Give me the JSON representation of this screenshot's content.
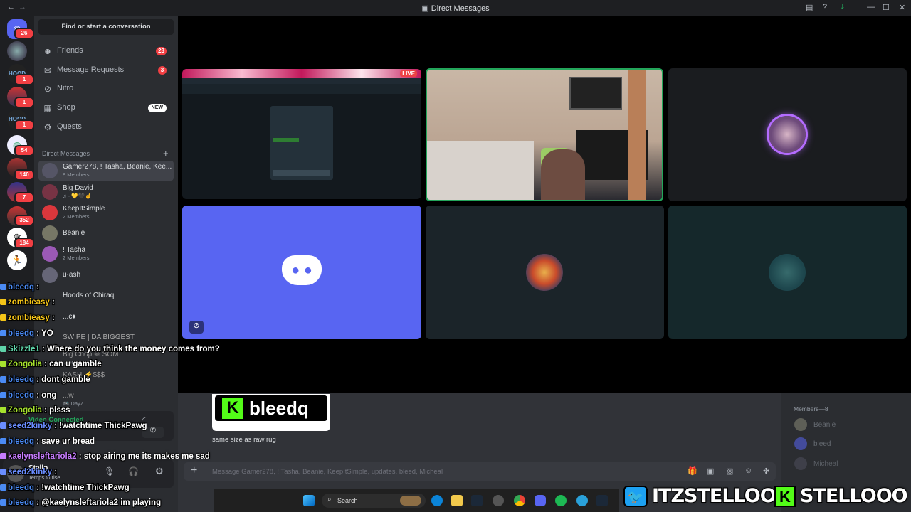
{
  "window": {
    "title": "Direct Messages"
  },
  "guild_badges": [
    "26",
    "1",
    "1",
    "1",
    "54",
    "140",
    "7",
    "352",
    "184"
  ],
  "dm_panel": {
    "find_label": "Find or start a conversation",
    "nav": [
      {
        "label": "Friends",
        "badge": "23",
        "icon": "friends-icon"
      },
      {
        "label": "Message Requests",
        "badge": "3",
        "icon": "mail-icon"
      },
      {
        "label": "Nitro",
        "badge": "",
        "icon": "nitro-icon"
      },
      {
        "label": "Shop",
        "badge": "NEW",
        "icon": "shop-icon"
      },
      {
        "label": "Quests",
        "badge": "",
        "icon": "quests-icon"
      }
    ],
    "dm_header": "Direct Messages",
    "dms": [
      {
        "name": "Gamer278, ! Tasha, Beanie, Kee...",
        "sub": "8 Members"
      },
      {
        "name": "Big David",
        "sub": "♫ · 💛🖤✌"
      },
      {
        "name": "KeepItSimple",
        "sub": "2 Members"
      },
      {
        "name": "Beanie",
        "sub": ""
      },
      {
        "name": "! Tasha",
        "sub": "2 Members"
      },
      {
        "name": "u·ash",
        "sub": ""
      },
      {
        "name": "Hoods of Chiraq",
        "sub": ""
      },
      {
        "name": "...c♦",
        "sub": ""
      },
      {
        "name": "SWIPE | DA BIGGEST",
        "sub": ""
      },
      {
        "name": "Big Chop  ☠ SOM",
        "sub": "...ter ...Medal"
      },
      {
        "name": "KASH ⚡$$$",
        "sub": ""
      },
      {
        "name": "...w",
        "sub": "🎮 DayZ"
      }
    ]
  },
  "stage": {
    "live_label": "LIVE"
  },
  "voice": {
    "status": "Video Connected"
  },
  "user": {
    "name": "Stello",
    "status": "Temps to rise"
  },
  "chat": {
    "image_text": "bleedq",
    "message": "same size as raw rug",
    "input_placeholder": "Message Gamer278, ! Tasha, Beanie, KeepItSimple, updates, bleed, Micheal"
  },
  "members": {
    "header": "Members—8",
    "items": [
      "Beanie",
      "bleed",
      "Micheal"
    ]
  },
  "taskbar": {
    "search_label": "Search"
  },
  "stream_chat": [
    {
      "user": "bleedq",
      "color": "#4b8bf5",
      "text": ""
    },
    {
      "user": "zombieasy",
      "color": "#f5c518",
      "text": ""
    },
    {
      "user": "zombieasy",
      "color": "#f5c518",
      "text": ""
    },
    {
      "user": "bleedq",
      "color": "#4b8bf5",
      "text": "YO"
    },
    {
      "user": "Skizzle1",
      "color": "#5fd3a8",
      "text": "Where do you think the money comes from?"
    },
    {
      "user": "Zongolia",
      "color": "#a6e22e",
      "text": "can u gamble"
    },
    {
      "user": "bleedq",
      "color": "#4b8bf5",
      "text": "dont gamble"
    },
    {
      "user": "bleedq",
      "color": "#4b8bf5",
      "text": "ong"
    },
    {
      "user": "Zongolia",
      "color": "#a6e22e",
      "text": "plsss"
    },
    {
      "user": "seed2kinky",
      "color": "#6a8dff",
      "text": "!watchtime ThickPawg"
    },
    {
      "user": "bleedq",
      "color": "#4b8bf5",
      "text": "save ur bread"
    },
    {
      "user": "kaelynsleftariola2",
      "color": "#c77dff",
      "text": "stop airing me its makes me sad"
    },
    {
      "user": "seed2kinky",
      "color": "#6a8dff",
      "text": ""
    },
    {
      "user": "bleedq",
      "color": "#4b8bf5",
      "text": "!watchtime ThickPawg"
    },
    {
      "user": "bleedq",
      "color": "#4b8bf5",
      "text": "@kaelynsleftariola2 im playing"
    }
  ],
  "banner": {
    "twitter": "ITZSTELLOO",
    "kick": "STELLOOO"
  },
  "colors": {
    "blurple": "#5865f2",
    "bg": "#313338",
    "sidebar": "#2b2d31",
    "red": "#f23f43",
    "kick_green": "#53fc18"
  }
}
